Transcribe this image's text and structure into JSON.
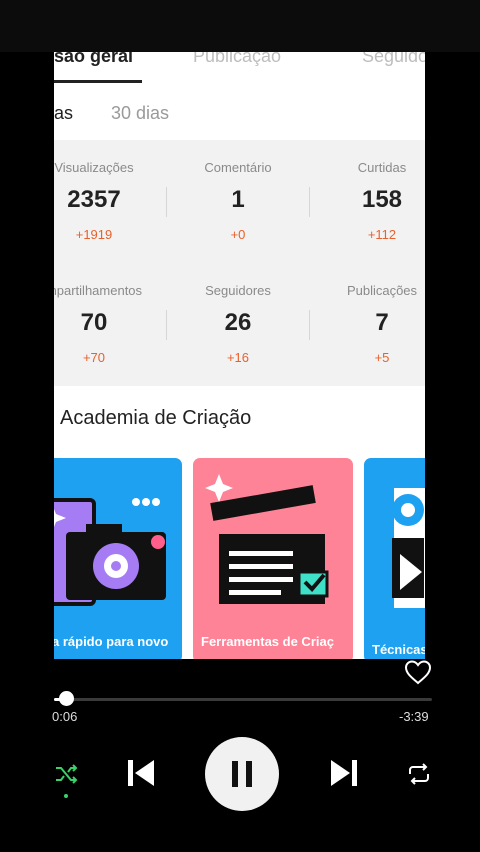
{
  "tabs": [
    "são geral",
    "Publicação",
    "Seguido"
  ],
  "subtabs": [
    "as",
    "30 dias"
  ],
  "stats": [
    {
      "label": "Visualizações",
      "value": "2357",
      "delta": "+1919"
    },
    {
      "label": "Comentário",
      "value": "1",
      "delta": "+0"
    },
    {
      "label": "Curtidas",
      "value": "158",
      "delta": "+112"
    },
    {
      "label": "mpartilhamentos",
      "value": "70",
      "delta": "+70"
    },
    {
      "label": "Seguidores",
      "value": "26",
      "delta": "+16"
    },
    {
      "label": "Publicações",
      "value": "7",
      "delta": "+5"
    }
  ],
  "academy_title": "Academia de Criação",
  "cards": [
    {
      "caption": "a rápido para novo",
      "color": "#1ea1f1"
    },
    {
      "caption": "Ferramentas de Criaç",
      "color": "#ff8397"
    },
    {
      "caption": "Técnicas",
      "color": "#1ea1f1"
    }
  ],
  "player": {
    "current_time": "0:06",
    "remaining_time": "-3:39",
    "progress": 0.027,
    "accent": "#e8612c"
  },
  "icons": [
    "heart-icon",
    "shuffle-icon",
    "previous-icon",
    "pause-icon",
    "next-icon",
    "repeat-icon"
  ]
}
